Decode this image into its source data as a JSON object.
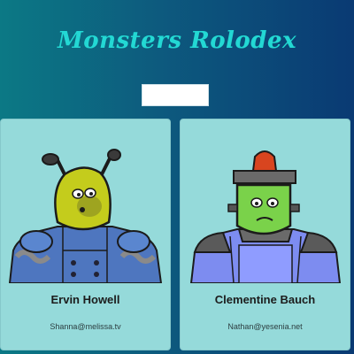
{
  "app": {
    "title": "Monsters Rolodex"
  },
  "search": {
    "placeholder": "",
    "value": ""
  },
  "monsters": [
    {
      "name": "Ervin Howell",
      "email": "Shanna@melissa.tv",
      "avatar_icon": "alien-monster-icon"
    },
    {
      "name": "Clementine Bauch",
      "email": "Nathan@yesenia.net",
      "avatar_icon": "frankenstein-monster-icon"
    }
  ],
  "colors": {
    "title": "#23d8d4",
    "card_background": "#95dada",
    "background_start": "#0c7985",
    "background_end": "#0a3a73"
  }
}
